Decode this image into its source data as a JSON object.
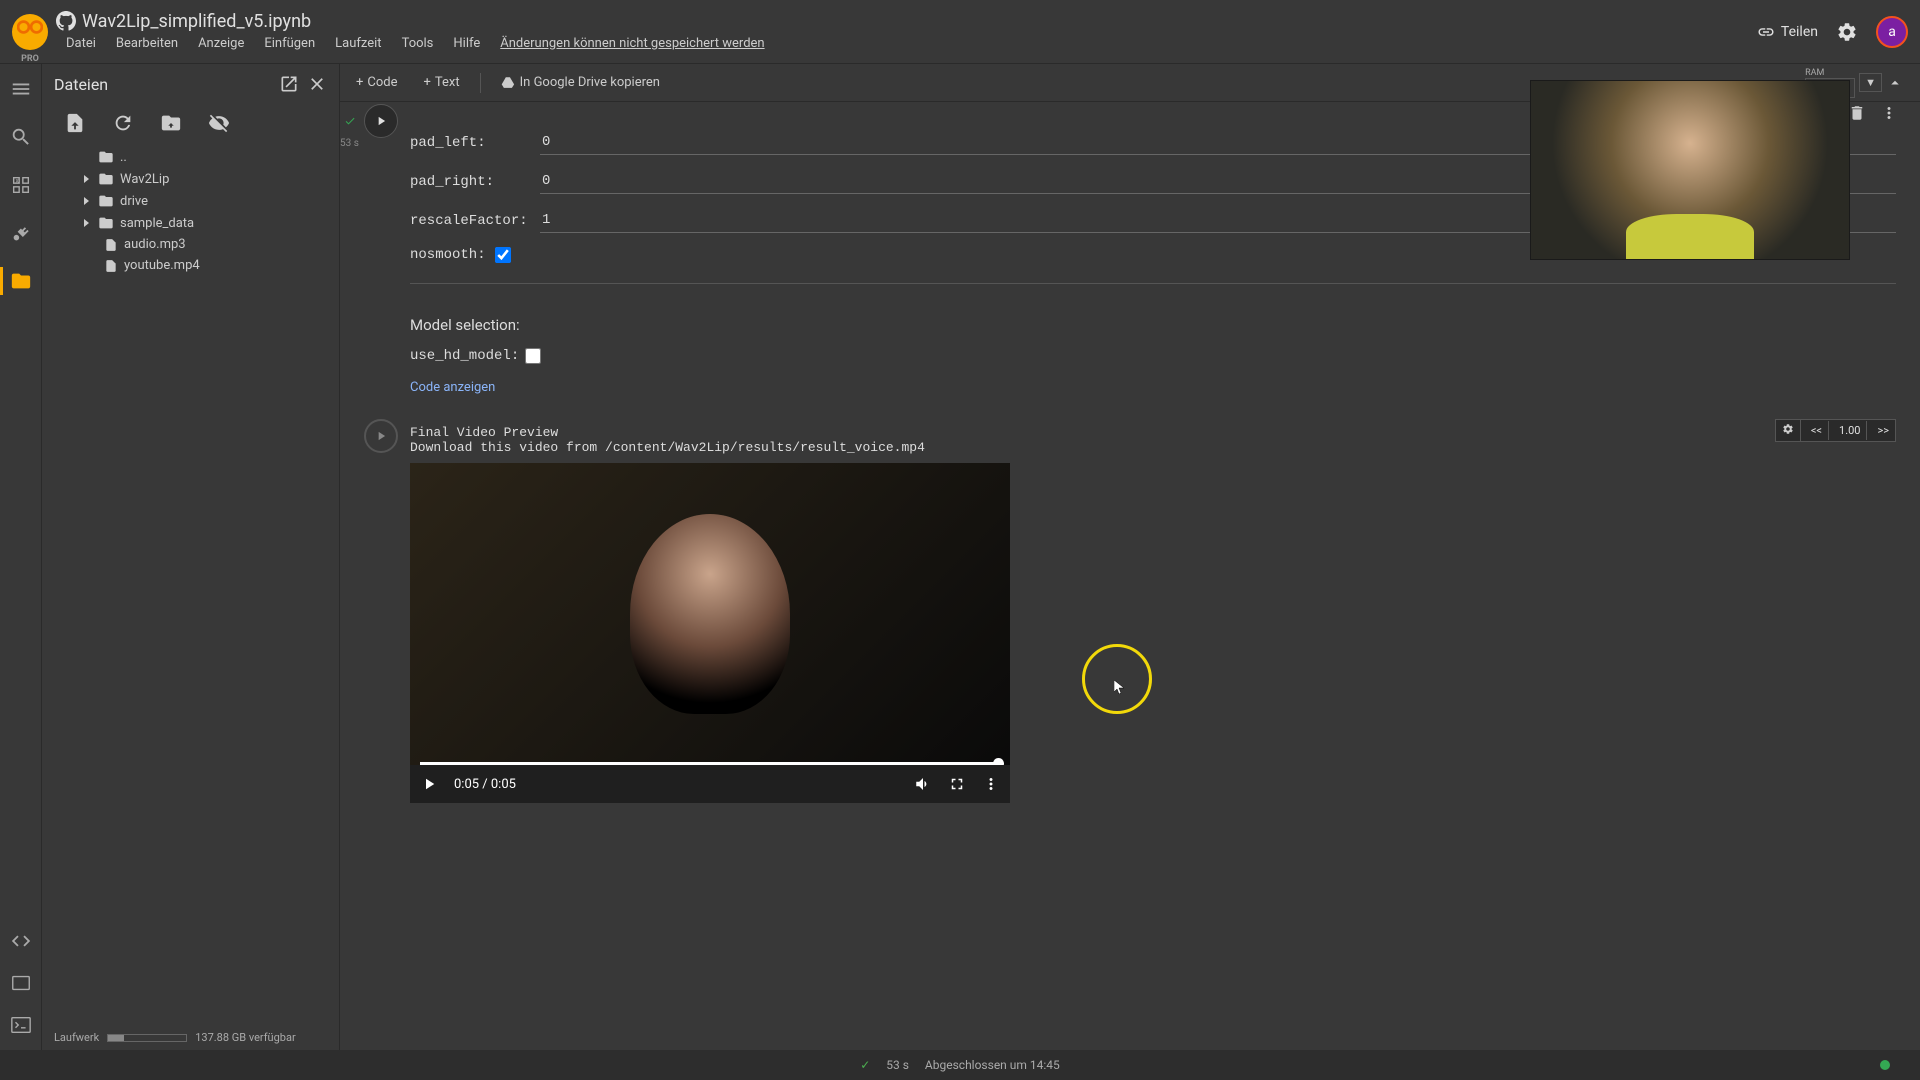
{
  "header": {
    "notebook_title": "Wav2Lip_simplified_v5.ipynb",
    "pro_badge": "PRO",
    "menu": [
      "Datei",
      "Bearbeiten",
      "Anzeige",
      "Einfügen",
      "Laufzeit",
      "Tools",
      "Hilfe"
    ],
    "warning": "Änderungen können nicht gespeichert werden",
    "share": "Teilen",
    "avatar_letter": "a"
  },
  "toolbar": {
    "code": "Code",
    "text": "Text",
    "copy_drive": "In Google Drive kopieren",
    "ram_label": "RAM"
  },
  "filepanel": {
    "title": "Dateien",
    "root_dots": "..",
    "items": [
      {
        "type": "folder",
        "name": "Wav2Lip",
        "expandable": true
      },
      {
        "type": "folder",
        "name": "drive",
        "expandable": true
      },
      {
        "type": "folder",
        "name": "sample_data",
        "expandable": true
      },
      {
        "type": "file",
        "name": "audio.mp3"
      },
      {
        "type": "file",
        "name": "youtube.mp4"
      }
    ],
    "disk_label": "Laufwerk",
    "disk_avail": "137.88 GB verfügbar"
  },
  "cell_form": {
    "exec_time": "53 s",
    "rows": [
      {
        "label": "pad_left:",
        "value": "0",
        "type": "text"
      },
      {
        "label": "pad_right:",
        "value": "0",
        "type": "text"
      },
      {
        "label": "rescaleFactor:",
        "value": "1",
        "type": "text"
      },
      {
        "label": "nosmooth:",
        "value": true,
        "type": "checkbox"
      }
    ],
    "model_section": "Model selection:",
    "hd_label": "use_hd_model:",
    "hd_checked": false,
    "show_code": "Code anzeigen"
  },
  "output_cell": {
    "title": "Final Video Preview",
    "subtitle": "Download this video from /content/Wav2Lip/results/result_voice.mp4",
    "video_time": "0:05 / 0:05",
    "playback_speed": "1.00"
  },
  "statusbar": {
    "checkmark_time": "53 s",
    "completed": "Abgeschlossen um 14:45"
  }
}
